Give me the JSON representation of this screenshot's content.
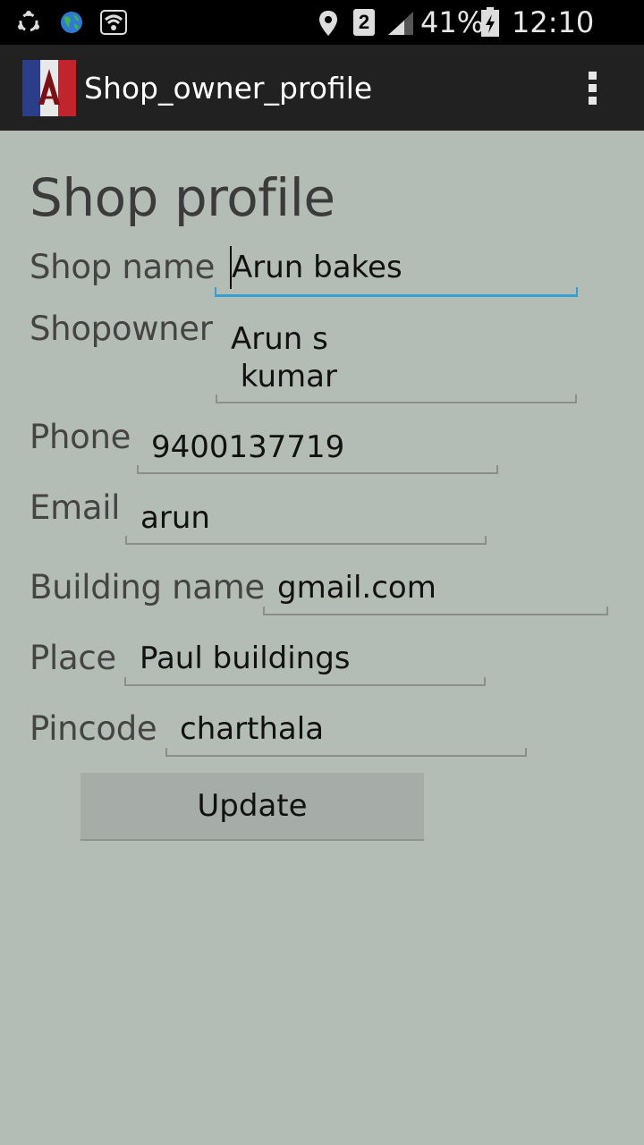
{
  "status_bar": {
    "battery": "41%",
    "time": "12:10 pm",
    "sim_badge": "2",
    "icons": [
      "sync-icon",
      "globe-icon",
      "wifi-icon",
      "location-icon",
      "sim-icon",
      "signal-icon",
      "battery-charging-icon"
    ]
  },
  "action_bar": {
    "title": "Shop_owner_profile",
    "logo": "app-logo-flag-icon",
    "menu": "overflow-menu-icon"
  },
  "form": {
    "title": "Shop profile",
    "shop_name_label": "Shop name",
    "shop_name_value": "Arun bakes",
    "shopowner_label": "Shopowner",
    "shopowner_value": "Arun s\n kumar",
    "phone_label": "Phone",
    "phone_value": "9400137719",
    "email_label": "Email",
    "email_value": "arun",
    "building_label": "Building name",
    "building_value": "gmail.com",
    "place_label": "Place",
    "place_value": "Paul buildings",
    "pincode_label": "Pincode",
    "pincode_value": "charthala",
    "update_label": "Update"
  },
  "colors": {
    "background": "#b4bdb5",
    "focus_accent": "#33a0d4",
    "action_bar": "#212121"
  }
}
